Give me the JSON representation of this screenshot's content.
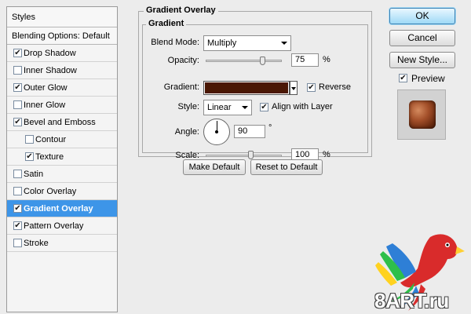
{
  "styles_panel": {
    "header": "Styles",
    "blending_options": "Blending Options: Default",
    "items": [
      {
        "label": "Drop Shadow",
        "checked": true
      },
      {
        "label": "Inner Shadow",
        "checked": false
      },
      {
        "label": "Outer Glow",
        "checked": true
      },
      {
        "label": "Inner Glow",
        "checked": false
      },
      {
        "label": "Bevel and Emboss",
        "checked": true
      },
      {
        "label": "Contour",
        "checked": false
      },
      {
        "label": "Texture",
        "checked": true
      },
      {
        "label": "Satin",
        "checked": false
      },
      {
        "label": "Color Overlay",
        "checked": false
      },
      {
        "label": "Gradient Overlay",
        "checked": true
      },
      {
        "label": "Pattern Overlay",
        "checked": true
      },
      {
        "label": "Stroke",
        "checked": false
      }
    ],
    "selected_index": 9
  },
  "gradient_overlay": {
    "title": "Gradient Overlay",
    "subtitle": "Gradient",
    "blend_mode_label": "Blend Mode:",
    "blend_mode_value": "Multiply",
    "opacity_label": "Opacity:",
    "opacity_value": "75",
    "opacity_unit": "%",
    "gradient_label": "Gradient:",
    "gradient_color": "#4a1704",
    "reverse_label": "Reverse",
    "reverse_checked": true,
    "style_label": "Style:",
    "style_value": "Linear",
    "align_label": "Align with Layer",
    "align_checked": true,
    "angle_label": "Angle:",
    "angle_value": "90",
    "angle_unit": "°",
    "scale_label": "Scale:",
    "scale_value": "100",
    "scale_unit": "%",
    "opacity_level": 0.75,
    "scale_level": 0.6,
    "make_default": "Make Default",
    "reset_default": "Reset to Default"
  },
  "actions": {
    "ok": "OK",
    "cancel": "Cancel",
    "new_style": "New Style...",
    "preview_label": "Preview",
    "preview_checked": true
  },
  "watermark": {
    "text": "8ART.ru",
    "icon": "parrot-logo"
  },
  "colors": {
    "selection": "#3d95e8",
    "ok_button": "#9ed9f6"
  }
}
